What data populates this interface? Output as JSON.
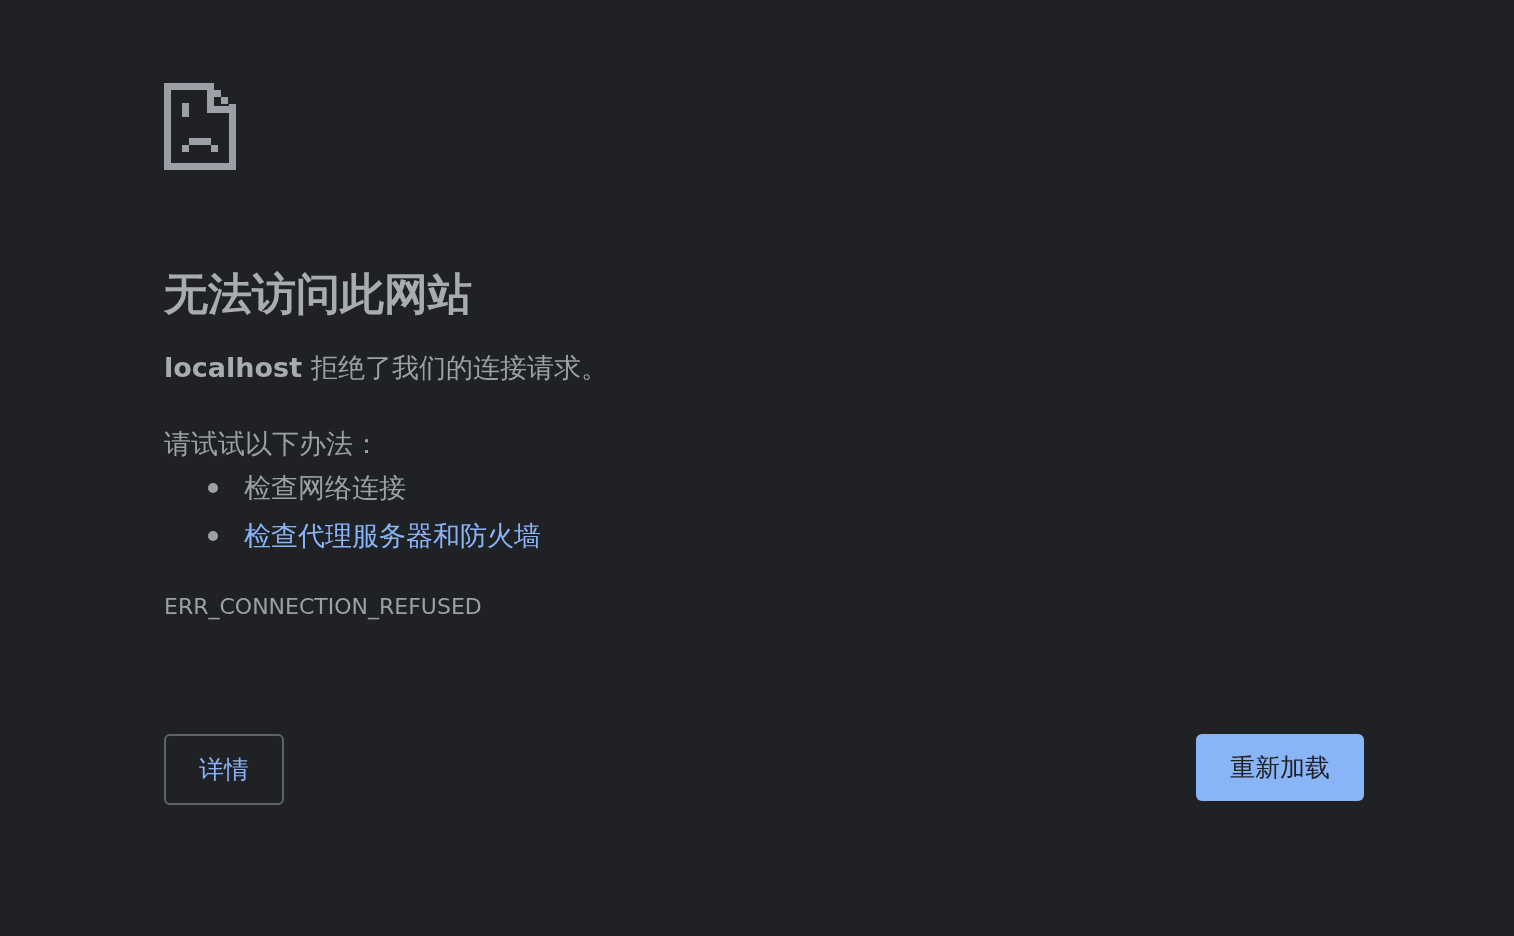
{
  "heading": "无法访问此网站",
  "message": "**localhost** 拒绝了我们的连接请求。",
  "suggestions_heading": "请试试以下办法：",
  "suggestions": [
    {
      "text": "检查网络连接",
      "kind": "text"
    },
    {
      "text": "检查代理服务器和防火墙",
      "kind": "link"
    }
  ],
  "error_code": "ERR_CONNECTION_REFUSED",
  "buttons": {
    "details": "详情",
    "reload": "重新加载"
  }
}
